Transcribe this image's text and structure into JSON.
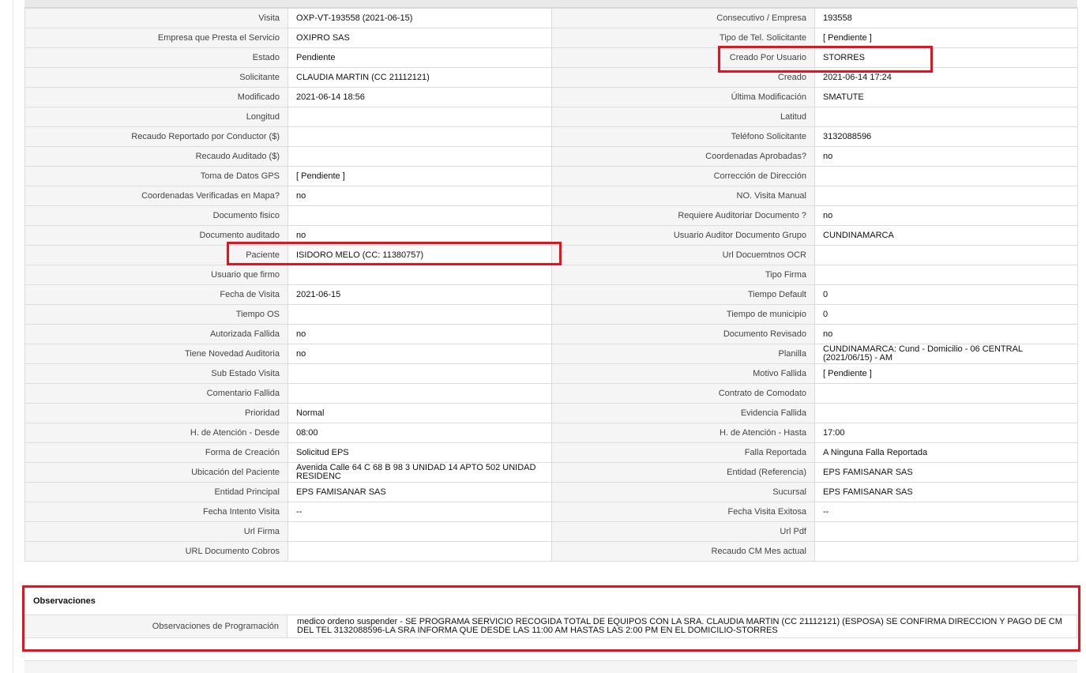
{
  "rows": [
    {
      "l1": "Visita",
      "v1": "OXP-VT-193558 (2021-06-15)",
      "l2": "Consecutivo / Empresa",
      "v2": "193558"
    },
    {
      "l1": "Empresa que Presta el Servicio",
      "v1": "OXIPRO SAS",
      "l2": "Tipo de Tel. Solicitante",
      "v2": "[ Pendiente ]"
    },
    {
      "l1": "Estado",
      "v1": "Pendiente",
      "l2": "Creado Por Usuario",
      "v2": "STORRES"
    },
    {
      "l1": "Solicitante",
      "v1": "CLAUDIA MARTIN (CC 21112121)",
      "l2": "Creado",
      "v2": "2021-06-14 17:24"
    },
    {
      "l1": "Modificado",
      "v1": "2021-06-14 18:56",
      "l2": "Última Modificación",
      "v2": " SMATUTE"
    },
    {
      "l1": "Longitud",
      "v1": "",
      "l2": "Latitud",
      "v2": ""
    },
    {
      "l1": "Recaudo Reportado por Conductor ($)",
      "v1": "",
      "l2": "Teléfono Solicitante",
      "v2": "3132088596"
    },
    {
      "l1": "Recaudo Auditado ($)",
      "v1": "",
      "l2": "Coordenadas Aprobadas?",
      "v2": " no"
    },
    {
      "l1": "Toma de Datos GPS",
      "v1": "[ Pendiente ]",
      "l2": "Corrección de Dirección",
      "v2": ""
    },
    {
      "l1": "Coordenadas Verificadas en Mapa?",
      "v1": " no",
      "l2": "NO. Visita Manual",
      "v2": ""
    },
    {
      "l1": "Documento fisico",
      "v1": "",
      "l2": "Requiere Auditoriar Documento ?",
      "v2": " no"
    },
    {
      "l1": "Documento auditado",
      "v1": " no",
      "l2": "Usuario Auditor Documento Grupo",
      "v2": "CUNDINAMARCA"
    },
    {
      "l1": "Paciente",
      "v1": "ISIDORO MELO (CC: 11380757)",
      "l2": "Url Docuemtnos OCR",
      "v2": ""
    },
    {
      "l1": "Usuario que firmo",
      "v1": "",
      "l2": "Tipo Firma",
      "v2": ""
    },
    {
      "l1": "Fecha de Visita",
      "v1": " 2021-06-15",
      "l2": "Tiempo Default",
      "v2": "0"
    },
    {
      "l1": "Tiempo OS",
      "v1": "",
      "l2": "Tiempo de municipio",
      "v2": "0"
    },
    {
      "l1": "Autorizada Fallida",
      "v1": " no",
      "l2": "Documento Revisado",
      "v2": " no"
    },
    {
      "l1": "Tiene Novedad Auditoria",
      "v1": " no",
      "l2": "Planilla",
      "v2": "CUNDINAMARCA: Cund - Domicilio - 06 CENTRAL (2021/06/15) - AM"
    },
    {
      "l1": "Sub Estado Visita",
      "v1": "",
      "l2": "Motivo Fallida",
      "v2": "[ Pendiente ]"
    },
    {
      "l1": "Comentario Fallida",
      "v1": "",
      "l2": "Contrato de Comodato",
      "v2": ""
    },
    {
      "l1": "Prioridad",
      "v1": "Normal",
      "l2": "Evidencia Fallida",
      "v2": ""
    },
    {
      "l1": "H. de Atención - Desde",
      "v1": "08:00",
      "l2": "H. de Atención - Hasta",
      "v2": "17:00"
    },
    {
      "l1": "Forma de Creación",
      "v1": "Solicitud EPS",
      "l2": "Falla Reportada",
      "v2": "A Ninguna Falla Reportada"
    },
    {
      "l1": "Ubicación del Paciente",
      "v1": "Avenida Calle 64 C 68 B 98 3 UNIDAD 14 APTO 502 UNIDAD RESIDENC",
      "l2": "Entidad (Referencia)",
      "v2": "EPS FAMISANAR SAS"
    },
    {
      "l1": "Entidad Principal",
      "v1": "EPS FAMISANAR SAS",
      "l2": "Sucursal",
      "v2": "EPS FAMISANAR SAS"
    },
    {
      "l1": "Fecha Intento Visita",
      "v1": " --",
      "l2": "Fecha Visita Exitosa",
      "v2": " --"
    },
    {
      "l1": "Url Firma",
      "v1": "",
      "l2": "Url Pdf",
      "v2": ""
    },
    {
      "l1": "URL Documento Cobros",
      "v1": "",
      "l2": "Recaudo CM Mes actual",
      "v2": ""
    }
  ],
  "observaciones": {
    "title": "Observaciones",
    "label": "Observaciones de Programación",
    "value": "  medico ordeno suspender - SE PROGRAMA SERVICIO RECOGIDA TOTAL DE EQUIPOS CON LA SRA. CLAUDIA MARTIN (CC 21112121) (ESPOSA) SE CONFIRMA DIRECCION Y PAGO DE CM DEL TEL 3132088596-LA SRA INFORMA QUE DESDE LAS 11:00 AM HASTAS LAS 2:00 PM EN EL DOMICILIO-STORRES"
  },
  "highlight_color": "#e8121f"
}
